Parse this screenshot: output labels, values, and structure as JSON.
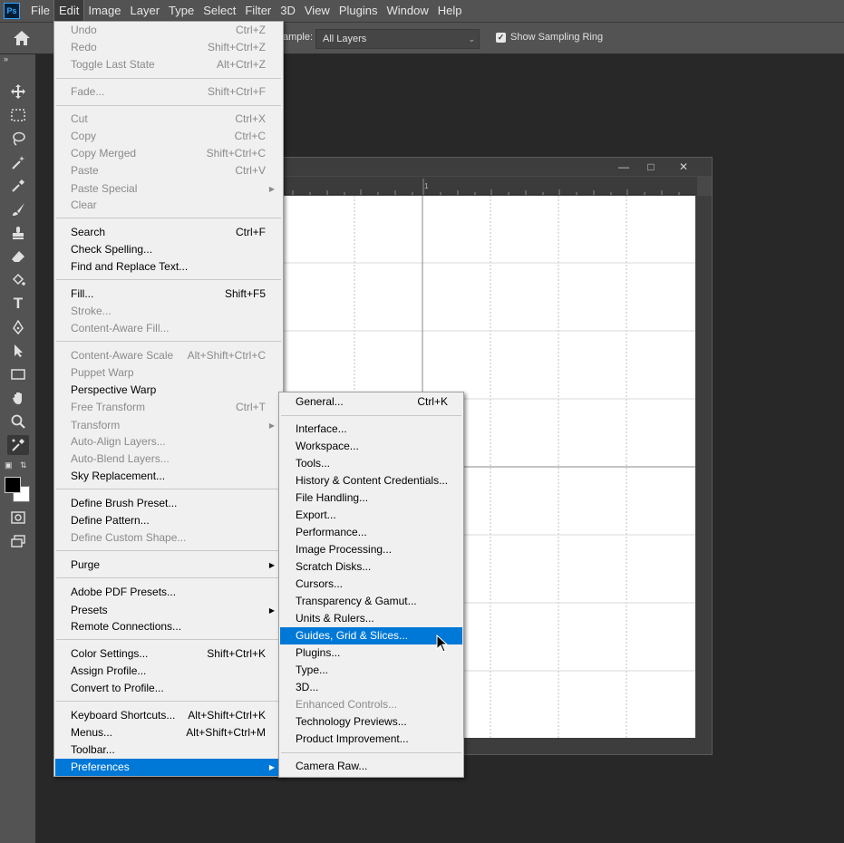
{
  "menubar": {
    "logo": "Ps",
    "items": [
      "File",
      "Edit",
      "Image",
      "Layer",
      "Type",
      "Select",
      "Filter",
      "3D",
      "View",
      "Plugins",
      "Window",
      "Help"
    ],
    "active": "Edit"
  },
  "options_bar": {
    "sample_label": "ample:",
    "sample_value": "All Layers",
    "show_sampling_ring_checked": true,
    "show_sampling_ring_label": "Show Sampling Ring"
  },
  "document": {
    "ruler_number": "1"
  },
  "edit_menu": {
    "items": [
      {
        "label": "Undo",
        "shortcut": "Ctrl+Z",
        "disabled": true
      },
      {
        "label": "Redo",
        "shortcut": "Shift+Ctrl+Z",
        "disabled": true
      },
      {
        "label": "Toggle Last State",
        "shortcut": "Alt+Ctrl+Z",
        "disabled": true
      },
      {
        "label": "Fade...",
        "shortcut": "Shift+Ctrl+F",
        "disabled": true
      },
      {
        "label": "Cut",
        "shortcut": "Ctrl+X",
        "disabled": true
      },
      {
        "label": "Copy",
        "shortcut": "Ctrl+C",
        "disabled": true
      },
      {
        "label": "Copy Merged",
        "shortcut": "Shift+Ctrl+C",
        "disabled": true
      },
      {
        "label": "Paste",
        "shortcut": "Ctrl+V",
        "disabled": true
      },
      {
        "label": "Paste Special",
        "shortcut": "",
        "disabled": true,
        "submenu": true
      },
      {
        "label": "Clear",
        "shortcut": "",
        "disabled": true
      },
      {
        "label": "Search",
        "shortcut": "Ctrl+F",
        "disabled": false
      },
      {
        "label": "Check Spelling...",
        "shortcut": "",
        "disabled": false
      },
      {
        "label": "Find and Replace Text...",
        "shortcut": "",
        "disabled": false
      },
      {
        "label": "Fill...",
        "shortcut": "Shift+F5",
        "disabled": false
      },
      {
        "label": "Stroke...",
        "shortcut": "",
        "disabled": true
      },
      {
        "label": "Content-Aware Fill...",
        "shortcut": "",
        "disabled": true
      },
      {
        "label": "Content-Aware Scale",
        "shortcut": "Alt+Shift+Ctrl+C",
        "disabled": true
      },
      {
        "label": "Puppet Warp",
        "shortcut": "",
        "disabled": true
      },
      {
        "label": "Perspective Warp",
        "shortcut": "",
        "disabled": false
      },
      {
        "label": "Free Transform",
        "shortcut": "Ctrl+T",
        "disabled": true
      },
      {
        "label": "Transform",
        "shortcut": "",
        "disabled": true,
        "submenu": true
      },
      {
        "label": "Auto-Align Layers...",
        "shortcut": "",
        "disabled": true
      },
      {
        "label": "Auto-Blend Layers...",
        "shortcut": "",
        "disabled": true
      },
      {
        "label": "Sky Replacement...",
        "shortcut": "",
        "disabled": false
      },
      {
        "label": "Define Brush Preset...",
        "shortcut": "",
        "disabled": false
      },
      {
        "label": "Define Pattern...",
        "shortcut": "",
        "disabled": false
      },
      {
        "label": "Define Custom Shape...",
        "shortcut": "",
        "disabled": true
      },
      {
        "label": "Purge",
        "shortcut": "",
        "disabled": false,
        "submenu": true
      },
      {
        "label": "Adobe PDF Presets...",
        "shortcut": "",
        "disabled": false
      },
      {
        "label": "Presets",
        "shortcut": "",
        "disabled": false,
        "submenu": true
      },
      {
        "label": "Remote Connections...",
        "shortcut": "",
        "disabled": false
      },
      {
        "label": "Color Settings...",
        "shortcut": "Shift+Ctrl+K",
        "disabled": false
      },
      {
        "label": "Assign Profile...",
        "shortcut": "",
        "disabled": false
      },
      {
        "label": "Convert to Profile...",
        "shortcut": "",
        "disabled": false
      },
      {
        "label": "Keyboard Shortcuts...",
        "shortcut": "Alt+Shift+Ctrl+K",
        "disabled": false
      },
      {
        "label": "Menus...",
        "shortcut": "Alt+Shift+Ctrl+M",
        "disabled": false
      },
      {
        "label": "Toolbar...",
        "shortcut": "",
        "disabled": false
      },
      {
        "label": "Preferences",
        "shortcut": "",
        "disabled": false,
        "submenu": true,
        "highlighted": true
      }
    ]
  },
  "preferences_menu": {
    "items": [
      {
        "label": "General...",
        "shortcut": "Ctrl+K",
        "disabled": false
      },
      {
        "label": "Interface...",
        "shortcut": "",
        "disabled": false
      },
      {
        "label": "Workspace...",
        "shortcut": "",
        "disabled": false
      },
      {
        "label": "Tools...",
        "shortcut": "",
        "disabled": false
      },
      {
        "label": "History & Content Credentials...",
        "shortcut": "",
        "disabled": false
      },
      {
        "label": "File Handling...",
        "shortcut": "",
        "disabled": false
      },
      {
        "label": "Export...",
        "shortcut": "",
        "disabled": false
      },
      {
        "label": "Performance...",
        "shortcut": "",
        "disabled": false
      },
      {
        "label": "Image Processing...",
        "shortcut": "",
        "disabled": false
      },
      {
        "label": "Scratch Disks...",
        "shortcut": "",
        "disabled": false
      },
      {
        "label": "Cursors...",
        "shortcut": "",
        "disabled": false
      },
      {
        "label": "Transparency & Gamut...",
        "shortcut": "",
        "disabled": false
      },
      {
        "label": "Units & Rulers...",
        "shortcut": "",
        "disabled": false
      },
      {
        "label": "Guides, Grid & Slices...",
        "shortcut": "",
        "disabled": false,
        "highlighted": true
      },
      {
        "label": "Plugins...",
        "shortcut": "",
        "disabled": false
      },
      {
        "label": "Type...",
        "shortcut": "",
        "disabled": false
      },
      {
        "label": "3D...",
        "shortcut": "",
        "disabled": false
      },
      {
        "label": "Enhanced Controls...",
        "shortcut": "",
        "disabled": true
      },
      {
        "label": "Technology Previews...",
        "shortcut": "",
        "disabled": false
      },
      {
        "label": "Product Improvement...",
        "shortcut": "",
        "disabled": false
      },
      {
        "label": "Camera Raw...",
        "shortcut": "",
        "disabled": false
      }
    ]
  },
  "colors": {
    "highlight": "#0078d7",
    "foreground_swatch": "#000000",
    "background_swatch": "#ffffff"
  }
}
